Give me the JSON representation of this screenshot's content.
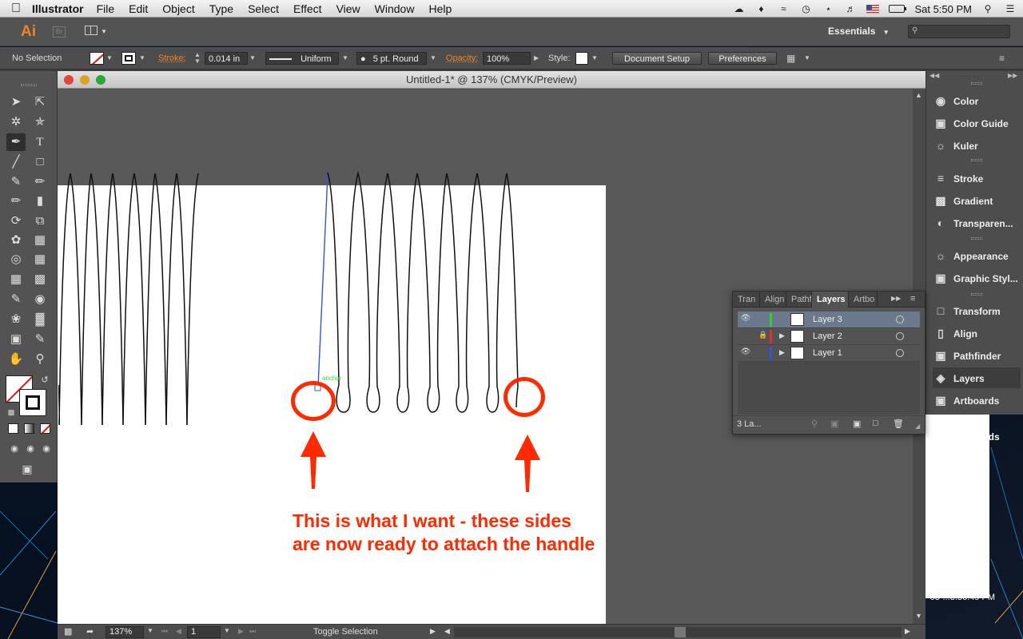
{
  "menubar": {
    "app_name": "Illustrator",
    "menus": [
      "File",
      "Edit",
      "Object",
      "Type",
      "Select",
      "Effect",
      "View",
      "Window",
      "Help"
    ],
    "clock": "Sat 5:50 PM"
  },
  "appbar": {
    "logo": "Ai",
    "bridge": "Br",
    "workspace": "Essentials"
  },
  "control": {
    "selection": "No Selection",
    "stroke_label": "Stroke:",
    "stroke_value": "0.014 in",
    "profile": "Uniform",
    "brush": "5 pt. Round",
    "opacity_label": "Opacity:",
    "opacity_value": "100%",
    "style_label": "Style:",
    "doc_setup": "Document Setup",
    "preferences": "Preferences"
  },
  "document": {
    "title": "Untitled-1* @ 137% (CMYK/Preview)",
    "zoom": "137%",
    "page": "1",
    "status": "Toggle Selection",
    "anchor_hint": "anchor"
  },
  "dock": {
    "items": [
      "Color",
      "Color Guide",
      "Kuler",
      "Stroke",
      "Gradient",
      "Transparen...",
      "Appearance",
      "Graphic Styl...",
      "Transform",
      "Align",
      "Pathfinder",
      "Layers",
      "Artboards"
    ]
  },
  "layers_panel": {
    "tabs": [
      "Tran",
      "Align",
      "Pathf",
      "Layers",
      "Artbo"
    ],
    "layers": [
      {
        "name": "Layer 3",
        "color": "#33cc33",
        "visible": true,
        "locked": false
      },
      {
        "name": "Layer 2",
        "color": "#e03030",
        "visible": false,
        "locked": true
      },
      {
        "name": "Layer 1",
        "color": "#3355dd",
        "visible": true,
        "locked": false
      }
    ],
    "count": "3 La..."
  },
  "annotation": {
    "line1": "This is what I want - these sides",
    "line2": "are now ready to attach the handle",
    "color": "#ff2a00"
  },
  "background": {
    "text1": "rds",
    "text2": "-03-...3.36.49 PM"
  }
}
